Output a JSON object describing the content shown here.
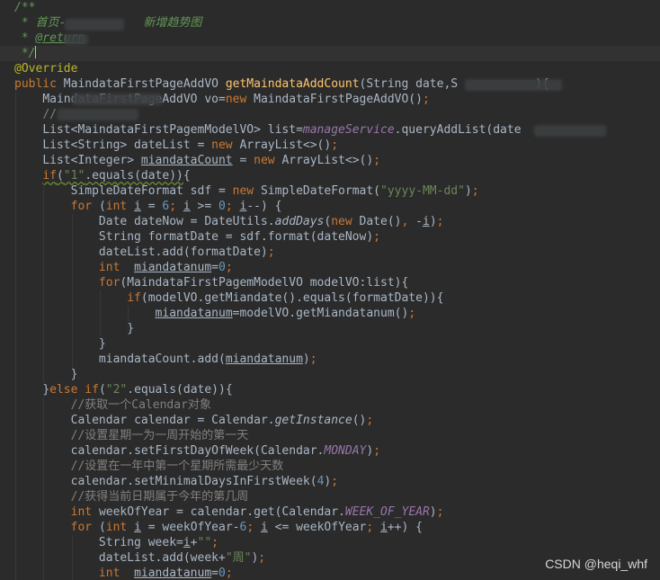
{
  "editor": {
    "language": "java",
    "colors": {
      "background": "#2b2b2b",
      "current_line": "#323232",
      "default": "#a9b7c6",
      "keyword": "#cc7832",
      "string": "#6a8759",
      "number": "#6897bb",
      "comment": "#808080",
      "javadoc": "#629755",
      "annotation": "#bbb529",
      "method_declaration": "#ffc66d",
      "constant": "#9876aa"
    },
    "lines": [
      {
        "indent": 0,
        "tokens": [
          {
            "t": "/**",
            "c": "doc"
          }
        ]
      },
      {
        "indent": 0,
        "tokens": [
          {
            "t": " * 首页-",
            "c": "doc"
          },
          {
            "t": "           ",
            "c": "doc"
          },
          {
            "t": "新增趋势图",
            "c": "doc"
          }
        ]
      },
      {
        "indent": 0,
        "tokens": [
          {
            "t": " * ",
            "c": "doc"
          },
          {
            "t": "@return",
            "c": "tag"
          }
        ]
      },
      {
        "indent": 0,
        "current": true,
        "tokens": [
          {
            "t": " */",
            "c": "doc"
          }
        ]
      },
      {
        "indent": 0,
        "tokens": [
          {
            "t": "@Override",
            "c": "ann"
          }
        ]
      },
      {
        "indent": 0,
        "tokens": [
          {
            "t": "public ",
            "c": "kw"
          },
          {
            "t": "MaindataFirstPageAddVO ",
            "c": "plain"
          },
          {
            "t": "getMaindataAddCount",
            "c": "fn"
          },
          {
            "t": "(String date,S",
            "c": "plain"
          },
          {
            "t": "           ",
            "c": "plain"
          },
          {
            "t": "){",
            "c": "plain"
          }
        ]
      },
      {
        "indent": 1,
        "tokens": [
          {
            "t": "MaindataFirstPageAddVO vo=",
            "c": "plain"
          },
          {
            "t": "new ",
            "c": "kw"
          },
          {
            "t": "MaindataFirstPageAddVO()",
            "c": "plain"
          },
          {
            "t": ";",
            "c": "kw"
          }
        ]
      },
      {
        "indent": 1,
        "tokens": [
          {
            "t": "//",
            "c": "cmt"
          }
        ]
      },
      {
        "indent": 1,
        "tokens": [
          {
            "t": "List<MaindataFirstPagemModelVO> list=",
            "c": "plain"
          },
          {
            "t": "manageService",
            "c": "con"
          },
          {
            "t": ".queryAddList(date",
            "c": "plain"
          }
        ]
      },
      {
        "indent": 1,
        "tokens": [
          {
            "t": "List<String> dateList = ",
            "c": "plain"
          },
          {
            "t": "new ",
            "c": "kw"
          },
          {
            "t": "ArrayList<>()",
            "c": "plain"
          },
          {
            "t": ";",
            "c": "kw"
          }
        ]
      },
      {
        "indent": 1,
        "tokens": [
          {
            "t": "List<Integer> ",
            "c": "plain"
          },
          {
            "t": "miandataCount",
            "c": "var"
          },
          {
            "t": " = ",
            "c": "plain"
          },
          {
            "t": "new ",
            "c": "kw"
          },
          {
            "t": "ArrayList<>()",
            "c": "plain"
          },
          {
            "t": ";",
            "c": "kw"
          }
        ]
      },
      {
        "indent": 1,
        "tokens": [
          {
            "t": "if",
            "c": "kwwarn"
          },
          {
            "t": "(",
            "c": "warn"
          },
          {
            "t": "\"1\"",
            "c": "strwarn"
          },
          {
            "t": ".equals(date))",
            "c": "warn"
          },
          {
            "t": "{",
            "c": "plain"
          }
        ]
      },
      {
        "indent": 2,
        "tokens": [
          {
            "t": "SimpleDateFormat sdf = ",
            "c": "plain"
          },
          {
            "t": "new ",
            "c": "kw"
          },
          {
            "t": "SimpleDateFormat(",
            "c": "plain"
          },
          {
            "t": "\"yyyy-MM-dd\"",
            "c": "str"
          },
          {
            "t": ")",
            "c": "plain"
          },
          {
            "t": ";",
            "c": "kw"
          }
        ]
      },
      {
        "indent": 2,
        "tokens": [
          {
            "t": "for ",
            "c": "kw"
          },
          {
            "t": "(",
            "c": "plain"
          },
          {
            "t": "int ",
            "c": "kw"
          },
          {
            "t": "i",
            "c": "var"
          },
          {
            "t": " = ",
            "c": "plain"
          },
          {
            "t": "6",
            "c": "num"
          },
          {
            "t": "; ",
            "c": "kw"
          },
          {
            "t": "i",
            "c": "var"
          },
          {
            "t": " >= ",
            "c": "plain"
          },
          {
            "t": "0",
            "c": "num"
          },
          {
            "t": "; ",
            "c": "kw"
          },
          {
            "t": "i",
            "c": "var"
          },
          {
            "t": "--) {",
            "c": "plain"
          }
        ]
      },
      {
        "indent": 3,
        "tokens": [
          {
            "t": "Date dateNow = DateUtils.",
            "c": "plain"
          },
          {
            "t": "addDays",
            "c": "stat"
          },
          {
            "t": "(",
            "c": "plain"
          },
          {
            "t": "new ",
            "c": "kw"
          },
          {
            "t": "Date()",
            "c": "plain"
          },
          {
            "t": ", ",
            "c": "kw"
          },
          {
            "t": "-",
            "c": "plain"
          },
          {
            "t": "i",
            "c": "var"
          },
          {
            "t": ")",
            "c": "plain"
          },
          {
            "t": ";",
            "c": "kw"
          }
        ]
      },
      {
        "indent": 3,
        "tokens": [
          {
            "t": "String formatDate = sdf.format(dateNow)",
            "c": "plain"
          },
          {
            "t": ";",
            "c": "kw"
          }
        ]
      },
      {
        "indent": 3,
        "tokens": [
          {
            "t": "dateList.add(formatDate)",
            "c": "plain"
          },
          {
            "t": ";",
            "c": "kw"
          }
        ]
      },
      {
        "indent": 3,
        "tokens": [
          {
            "t": "int  ",
            "c": "kw"
          },
          {
            "t": "miandatanum",
            "c": "var"
          },
          {
            "t": "=",
            "c": "plain"
          },
          {
            "t": "0",
            "c": "num"
          },
          {
            "t": ";",
            "c": "kw"
          }
        ]
      },
      {
        "indent": 3,
        "tokens": [
          {
            "t": "for",
            "c": "kw"
          },
          {
            "t": "(MaindataFirstPagemModelVO modelVO:list){",
            "c": "plain"
          }
        ]
      },
      {
        "indent": 4,
        "tokens": [
          {
            "t": "if",
            "c": "kw"
          },
          {
            "t": "(modelVO.getMiandate().equals(formatDate)){",
            "c": "plain"
          }
        ]
      },
      {
        "indent": 5,
        "tokens": [
          {
            "t": "miandatanum",
            "c": "var"
          },
          {
            "t": "=modelVO.getMiandatanum()",
            "c": "plain"
          },
          {
            "t": ";",
            "c": "kw"
          }
        ]
      },
      {
        "indent": 4,
        "tokens": [
          {
            "t": "}",
            "c": "plain"
          }
        ]
      },
      {
        "indent": 3,
        "tokens": [
          {
            "t": "}",
            "c": "plain"
          }
        ]
      },
      {
        "indent": 3,
        "tokens": [
          {
            "t": "miandataCount.add(",
            "c": "plain"
          },
          {
            "t": "miandatanum",
            "c": "var"
          },
          {
            "t": ")",
            "c": "plain"
          },
          {
            "t": ";",
            "c": "kw"
          }
        ]
      },
      {
        "indent": 2,
        "tokens": [
          {
            "t": "}",
            "c": "plain"
          }
        ]
      },
      {
        "indent": 1,
        "tokens": [
          {
            "t": "}",
            "c": "plain"
          },
          {
            "t": "else if",
            "c": "kw"
          },
          {
            "t": "(",
            "c": "plain"
          },
          {
            "t": "\"2\"",
            "c": "str"
          },
          {
            "t": ".equals(date)){",
            "c": "plain"
          }
        ]
      },
      {
        "indent": 2,
        "tokens": [
          {
            "t": "//获取一个Calendar对象",
            "c": "cmt"
          }
        ]
      },
      {
        "indent": 2,
        "tokens": [
          {
            "t": "Calendar calendar = Calendar.",
            "c": "plain"
          },
          {
            "t": "getInstance",
            "c": "stat"
          },
          {
            "t": "()",
            "c": "plain"
          },
          {
            "t": ";",
            "c": "kw"
          }
        ]
      },
      {
        "indent": 2,
        "tokens": [
          {
            "t": "//设置星期一为一周开始的第一天",
            "c": "cmt"
          }
        ]
      },
      {
        "indent": 2,
        "tokens": [
          {
            "t": "calendar.setFirstDayOfWeek(Calendar.",
            "c": "plain"
          },
          {
            "t": "MONDAY",
            "c": "con"
          },
          {
            "t": ")",
            "c": "plain"
          },
          {
            "t": ";",
            "c": "kw"
          }
        ]
      },
      {
        "indent": 2,
        "tokens": [
          {
            "t": "//设置在一年中第一个星期所需最少天数",
            "c": "cmt"
          }
        ]
      },
      {
        "indent": 2,
        "tokens": [
          {
            "t": "calendar.setMinimalDaysInFirstWeek(",
            "c": "plain"
          },
          {
            "t": "4",
            "c": "num"
          },
          {
            "t": ")",
            "c": "plain"
          },
          {
            "t": ";",
            "c": "kw"
          }
        ]
      },
      {
        "indent": 2,
        "tokens": [
          {
            "t": "//获得当前日期属于今年的第几周",
            "c": "cmt"
          }
        ]
      },
      {
        "indent": 2,
        "tokens": [
          {
            "t": "int ",
            "c": "kw"
          },
          {
            "t": "weekOfYear = calendar.get(Calendar.",
            "c": "plain"
          },
          {
            "t": "WEEK_OF_YEAR",
            "c": "con"
          },
          {
            "t": ")",
            "c": "plain"
          },
          {
            "t": ";",
            "c": "kw"
          }
        ]
      },
      {
        "indent": 2,
        "tokens": [
          {
            "t": "for ",
            "c": "kw"
          },
          {
            "t": "(",
            "c": "plain"
          },
          {
            "t": "int ",
            "c": "kw"
          },
          {
            "t": "i",
            "c": "var"
          },
          {
            "t": " = weekOfYear-",
            "c": "plain"
          },
          {
            "t": "6",
            "c": "num"
          },
          {
            "t": "; ",
            "c": "kw"
          },
          {
            "t": "i",
            "c": "var"
          },
          {
            "t": " <= weekOfYear",
            "c": "plain"
          },
          {
            "t": "; ",
            "c": "kw"
          },
          {
            "t": "i",
            "c": "var"
          },
          {
            "t": "++) {",
            "c": "plain"
          }
        ]
      },
      {
        "indent": 3,
        "tokens": [
          {
            "t": "String week=",
            "c": "plain"
          },
          {
            "t": "i",
            "c": "var"
          },
          {
            "t": "+",
            "c": "plain"
          },
          {
            "t": "\"\"",
            "c": "str"
          },
          {
            "t": ";",
            "c": "kw"
          }
        ]
      },
      {
        "indent": 3,
        "tokens": [
          {
            "t": "dateList.add(week+",
            "c": "plain"
          },
          {
            "t": "\"周\"",
            "c": "str"
          },
          {
            "t": ")",
            "c": "plain"
          },
          {
            "t": ";",
            "c": "kw"
          }
        ]
      },
      {
        "indent": 3,
        "tokens": [
          {
            "t": "int  ",
            "c": "kw"
          },
          {
            "t": "miandatanum",
            "c": "var"
          },
          {
            "t": "=",
            "c": "plain"
          },
          {
            "t": "0",
            "c": "num"
          },
          {
            "t": ";",
            "c": "kw"
          }
        ]
      }
    ]
  },
  "watermark": "CSDN @heqi_whf"
}
